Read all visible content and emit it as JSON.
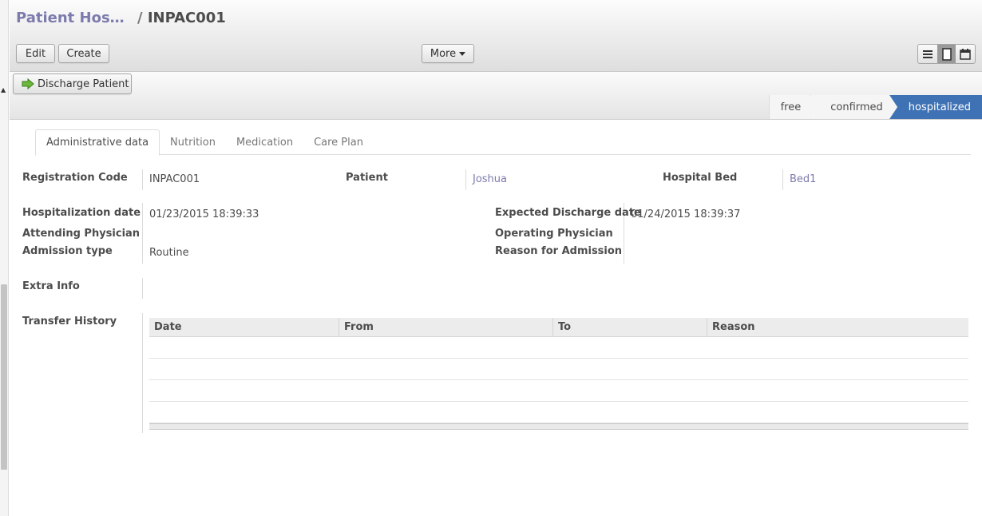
{
  "breadcrumb": {
    "parent": "Patient Hos…",
    "separator": "/",
    "current": "INPAC001"
  },
  "toolbar": {
    "edit_label": "Edit",
    "create_label": "Create",
    "more_label": "More"
  },
  "view_switch": {
    "active": "form",
    "icons": [
      "list-icon",
      "form-icon",
      "calendar-icon"
    ]
  },
  "header_actions": {
    "discharge_label": "Discharge Patient"
  },
  "stages": {
    "items": [
      "free",
      "confirmed",
      "hospitalized"
    ],
    "active": "hospitalized",
    "active_color": "#3f72b4"
  },
  "tabs": {
    "items": [
      "Administrative data",
      "Nutrition",
      "Medication",
      "Care Plan"
    ],
    "active": "Administrative data"
  },
  "form": {
    "registration_code_label": "Registration Code",
    "registration_code": "INPAC001",
    "patient_label": "Patient",
    "patient": "Joshua",
    "hospital_bed_label": "Hospital Bed",
    "hospital_bed": "Bed1",
    "hospitalization_date_label": "Hospitalization date",
    "hospitalization_date": "01/23/2015 18:39:33",
    "expected_discharge_label": "Expected Discharge date",
    "expected_discharge": "01/24/2015 18:39:37",
    "attending_physician_label": "Attending Physician",
    "attending_physician": "",
    "operating_physician_label": "Operating Physician",
    "operating_physician": "",
    "admission_type_label": "Admission type",
    "admission_type": "Routine",
    "reason_label": "Reason for Admission",
    "reason": "",
    "extra_info_label": "Extra Info",
    "extra_info": "",
    "transfer_history_label": "Transfer History"
  },
  "transfer_history": {
    "columns": [
      "Date",
      "From",
      "To",
      "Reason"
    ],
    "rows": []
  },
  "colors": {
    "link": "#7c7bad",
    "accent": "#3f72b4"
  }
}
